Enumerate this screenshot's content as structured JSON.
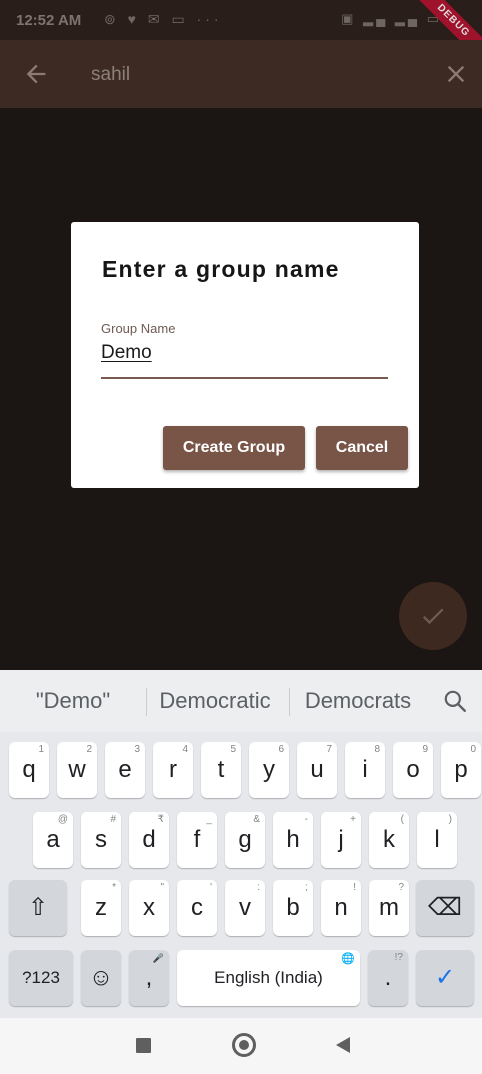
{
  "status_bar": {
    "time": "12:52 AM",
    "left_icons": "⊚ ♥ ✉ ▭ ···",
    "right_icons": "▣ ▂▄ ▂▄ ▭",
    "debug_banner": "DEBUG"
  },
  "app_bar": {
    "title": "sahil",
    "back_icon": "arrow-back-icon",
    "close_icon": "close-icon"
  },
  "dialog": {
    "title": "Enter a group name",
    "field_label": "Group Name",
    "field_value": "Demo",
    "create_label": "Create Group",
    "cancel_label": "Cancel"
  },
  "fab": {
    "icon": "check-icon"
  },
  "keyboard": {
    "suggestions": [
      "\"Demo\"",
      "Democratic",
      "Democrats"
    ],
    "row1": [
      {
        "k": "q",
        "h": "1"
      },
      {
        "k": "w",
        "h": "2"
      },
      {
        "k": "e",
        "h": "3"
      },
      {
        "k": "r",
        "h": "4"
      },
      {
        "k": "t",
        "h": "5"
      },
      {
        "k": "y",
        "h": "6"
      },
      {
        "k": "u",
        "h": "7"
      },
      {
        "k": "i",
        "h": "8"
      },
      {
        "k": "o",
        "h": "9"
      },
      {
        "k": "p",
        "h": "0"
      }
    ],
    "row2": [
      {
        "k": "a",
        "h": "@"
      },
      {
        "k": "s",
        "h": "#"
      },
      {
        "k": "d",
        "h": "₹"
      },
      {
        "k": "f",
        "h": "_"
      },
      {
        "k": "g",
        "h": "&"
      },
      {
        "k": "h",
        "h": "-"
      },
      {
        "k": "j",
        "h": "+"
      },
      {
        "k": "k",
        "h": "("
      },
      {
        "k": "l",
        "h": ")"
      }
    ],
    "row3": [
      {
        "k": "z",
        "h": "*"
      },
      {
        "k": "x",
        "h": "\""
      },
      {
        "k": "c",
        "h": "'"
      },
      {
        "k": "v",
        "h": ":"
      },
      {
        "k": "b",
        "h": ";"
      },
      {
        "k": "n",
        "h": "!"
      },
      {
        "k": "m",
        "h": "?"
      }
    ],
    "shift_label": "⇧",
    "backspace_label": "⌫",
    "symbols_label": "?123",
    "emoji_label": "☺",
    "comma_label": ",",
    "comma_hint": "🎤",
    "space_label": "English (India)",
    "space_hint": "🌐",
    "period_label": ".",
    "period_hint": "!?",
    "enter_label": "✓"
  },
  "colors": {
    "accent": "#795548",
    "app_bar": "#3d2b23",
    "keyboard_bg": "#e6e8eb"
  }
}
